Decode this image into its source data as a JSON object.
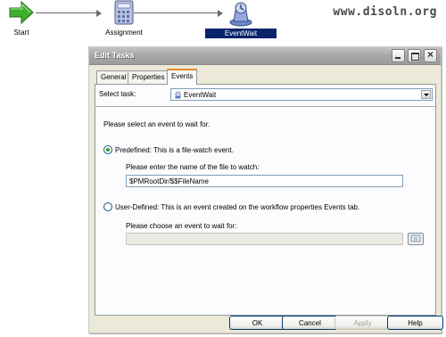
{
  "watermark": "www.disoln.org",
  "workflow": {
    "nodes": [
      {
        "label": "Start",
        "icon": "start-arrow-icon"
      },
      {
        "label": "Assignment",
        "icon": "calculator-icon"
      },
      {
        "label": "EventWait",
        "icon": "event-wait-icon",
        "selected": true
      }
    ]
  },
  "dialog": {
    "title": "Edit Tasks",
    "tabs": [
      {
        "label": "General"
      },
      {
        "label": "Properties"
      },
      {
        "label": "Events",
        "active": true
      }
    ],
    "select_task_label": "Select task:",
    "select_task_value": "EventWait",
    "instruction": "Please select an event to wait for.",
    "predefined": {
      "label": "Predefined: This is a file-watch event.",
      "checked": true,
      "file_prompt": "Please enter the name of the file to watch:",
      "file_value": "$PMRootDir/$$FileName"
    },
    "user_defined": {
      "label": "User-Defined: This is an event created on the workflow properties Events tab.",
      "checked": false,
      "event_prompt": "Please choose an event to wait for:",
      "event_value": ""
    },
    "buttons": {
      "ok": "OK",
      "cancel": "Cancel",
      "apply": "Apply",
      "help": "Help"
    }
  },
  "colors": {
    "selection": "#0a246a",
    "dialog_bg": "#ece9d8",
    "tab_accent": "#e68b2c",
    "radio_dot": "#21a121"
  }
}
